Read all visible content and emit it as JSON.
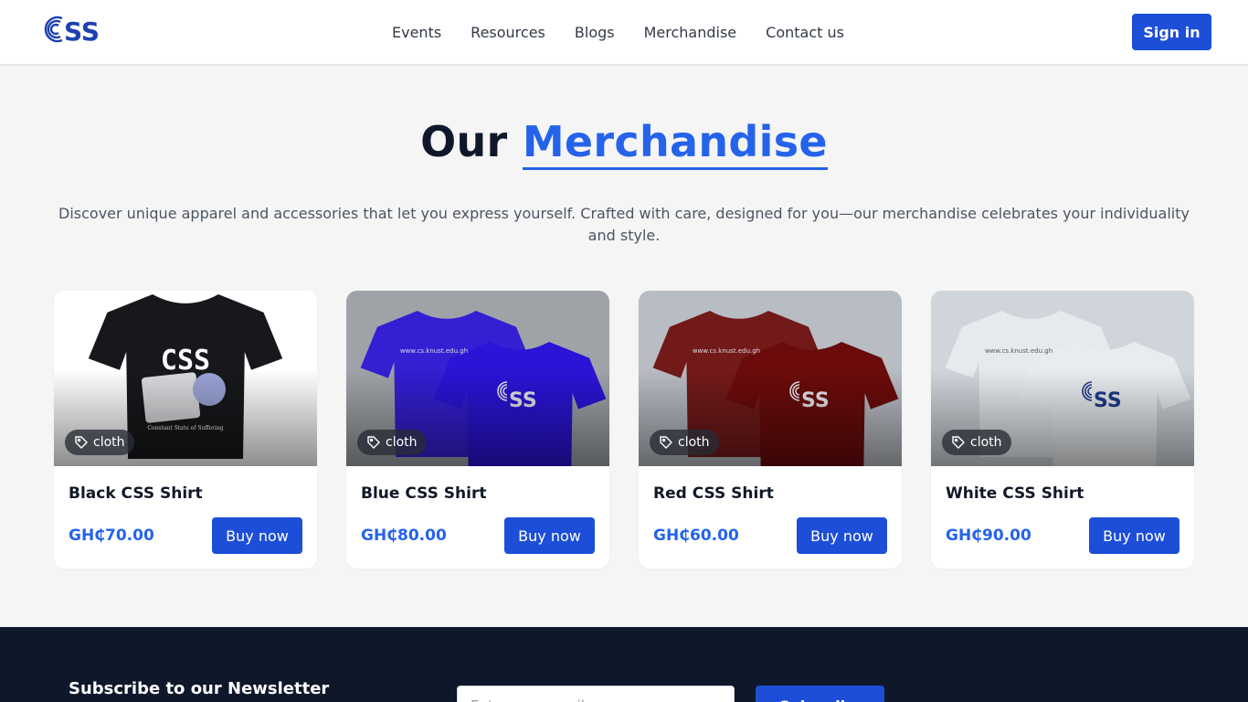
{
  "header": {
    "nav": [
      "Events",
      "Resources",
      "Blogs",
      "Merchandise",
      "Contact us"
    ],
    "signin_label": "Sign in"
  },
  "hero": {
    "title_prefix": "Our",
    "title_accent": "Merchandise",
    "subtitle": "Discover unique apparel and accessories that let you express yourself. Crafted with care, designed for you—our merchandise celebrates your individuality and style."
  },
  "products": [
    {
      "name": "Black CSS Shirt",
      "price": "GH₵70.00",
      "tag": "cloth",
      "buy_label": "Buy now",
      "shirt_color": "#17181b",
      "bg_color": "#ffffff",
      "image_text": "CSS",
      "image_caption": "Constant State of Suffering"
    },
    {
      "name": "Blue CSS Shirt",
      "price": "GH₵80.00",
      "tag": "cloth",
      "buy_label": "Buy now",
      "shirt_color": "#2a14d6",
      "bg_color": "#9fa3a8",
      "image_text": "www.cs.knust.edu.gh"
    },
    {
      "name": "Red CSS Shirt",
      "price": "GH₵60.00",
      "tag": "cloth",
      "buy_label": "Buy now",
      "shirt_color": "#6b0b0b",
      "bg_color": "#b8bcc3",
      "image_text": "www.cs.knust.edu.gh"
    },
    {
      "name": "White CSS Shirt",
      "price": "GH₵90.00",
      "tag": "cloth",
      "buy_label": "Buy now",
      "shirt_color": "#e8ecef",
      "bg_color": "#cfd5db",
      "image_text": "www.cs.knust.edu.gh"
    }
  ],
  "footer": {
    "newsletter_title": "Subscribe to our Newsletter",
    "email_placeholder": "Enter your email",
    "subscribe_label": "Subscribe"
  },
  "colors": {
    "accent": "#2563eb",
    "button": "#1d4ed8",
    "footer_bg": "#0f172a"
  },
  "icons": {
    "tag": "tag-icon",
    "logo": "css-logo"
  }
}
